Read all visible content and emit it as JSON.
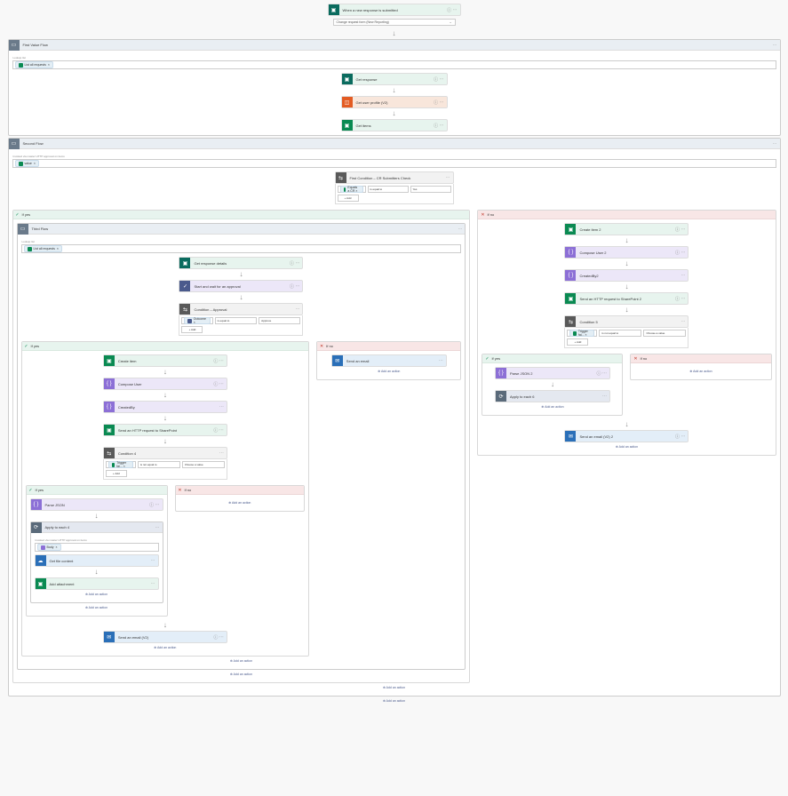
{
  "trigger": {
    "label": "When a new response is submitted",
    "dropdown": "Change request form (New Reporting)"
  },
  "scope1": {
    "title": "First Value Flow",
    "note": "Lookup list",
    "field_label": "List all requests",
    "a1": "Get response",
    "a2": "Get user profile (V2)",
    "a3": "Get items"
  },
  "scope2": {
    "title": "Second Flow",
    "note": "Invoked via master HTTP approval on items",
    "field_label": "value",
    "cond": {
      "title": "First Condition – CR Submitters Check",
      "c1": "Equals a CR ×",
      "c2": "is equal to",
      "c3": "Yes",
      "add": "+ Add"
    },
    "yes": {
      "label": "If yes",
      "inner_scope": {
        "title": "Third Flow",
        "note": "Lookup list",
        "field_label": "List all requests",
        "a1": "Get response details",
        "a2": "Start and wait for an approval",
        "cond": {
          "title": "Condition – Approval",
          "c1": "Outcome ×",
          "c2": "is equal to",
          "c3": "Approve",
          "add": "+ Add"
        },
        "yes": {
          "label": "If yes",
          "b1": "Create item",
          "b2": "Compose User",
          "b3": "CreatedBy",
          "b4": "Send an HTTP request to SharePoint",
          "cond2": {
            "title": "Condition 4",
            "c1": "Trigger fai... ×",
            "c2": "is not equal to",
            "c3": "Choose a value",
            "add": "+ Add"
          },
          "yes2": {
            "label": "If yes",
            "r1": "Parse JSON",
            "apply": {
              "title": "Apply to each 4",
              "note": "Invoked via master HTTP approval on items",
              "field": "Body",
              "g1": "Get file content",
              "g2": "Add attachment"
            },
            "add": "Add an action"
          },
          "no2": {
            "label": "If no",
            "add": "Add an action"
          },
          "after": "Send an email (V2)",
          "add_after": "Add an action"
        },
        "no": {
          "label": "If no",
          "e1": "Send an email",
          "add": "Add an action"
        }
      },
      "add": "Add an action"
    },
    "no": {
      "label": "If no",
      "n1": "Create item 2",
      "n2": "Compose User 2",
      "n3": "CreatedBy2",
      "n4": "Send an HTTP request to SharePoint 2",
      "cond": {
        "title": "Condition 5",
        "c1": "Trigger fai... ×",
        "c2": "is not equal to",
        "c3": "Choose a value",
        "add": "+ Add"
      },
      "yes": {
        "label": "If yes",
        "r1": "Parse JSON 2",
        "apply": {
          "title": "Apply to each 6"
        },
        "add": "Add an action"
      },
      "no2": {
        "label": "If no",
        "add": "Add an action"
      },
      "after": "Send an email (V2) 2",
      "add_after": "Add an action"
    },
    "add_bottom": "Add an action"
  },
  "outer_add": "Add an action",
  "ui": {
    "ellipsis": "⋯",
    "info": "ⓘ",
    "chev": "⌄"
  }
}
